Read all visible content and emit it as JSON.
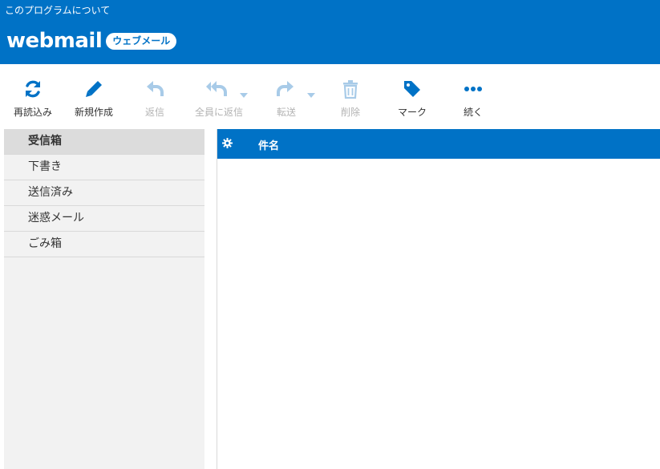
{
  "header": {
    "about_label": "このプログラムについて",
    "logo_text": "webmail",
    "logo_badge": "ウェブメール",
    "bg_color": "#0072c6"
  },
  "toolbar": {
    "buttons": [
      {
        "label": "再読込み",
        "icon": "refresh-icon",
        "enabled": true
      },
      {
        "label": "新規作成",
        "icon": "pencil-icon",
        "enabled": true
      },
      {
        "label": "返信",
        "icon": "reply-icon",
        "enabled": false
      },
      {
        "label": "全員に返信",
        "icon": "reply-all-icon",
        "enabled": false
      },
      {
        "label": "転送",
        "icon": "forward-icon",
        "enabled": false
      },
      {
        "label": "削除",
        "icon": "trash-icon",
        "enabled": false
      },
      {
        "label": "マーク",
        "icon": "tag-icon",
        "enabled": true
      },
      {
        "label": "続く",
        "icon": "more-icon",
        "enabled": true
      }
    ]
  },
  "folders": [
    {
      "label": "受信箱",
      "selected": true
    },
    {
      "label": "下書き",
      "selected": false
    },
    {
      "label": "送信済み",
      "selected": false
    },
    {
      "label": "迷惑メール",
      "selected": false
    },
    {
      "label": "ごみ箱",
      "selected": false
    }
  ],
  "message_list": {
    "columns": [
      "件名"
    ],
    "settings_icon": "gear-icon"
  }
}
